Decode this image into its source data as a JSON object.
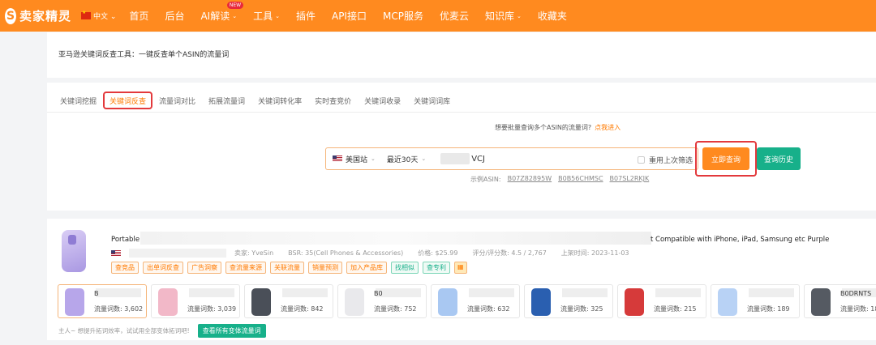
{
  "topbar": {
    "brand": "卖家精灵",
    "logo_letter": "S",
    "language": "中文",
    "nav": [
      {
        "label": "首页",
        "chevron": false
      },
      {
        "label": "后台",
        "chevron": false
      },
      {
        "label": "AI解读",
        "chevron": true,
        "badge": "NEW"
      },
      {
        "label": "工具",
        "chevron": true
      },
      {
        "label": "插件",
        "chevron": false
      },
      {
        "label": "API接口",
        "chevron": false
      },
      {
        "label": "MCP服务",
        "chevron": false
      },
      {
        "label": "优麦云",
        "chevron": false
      },
      {
        "label": "知识库",
        "chevron": true
      },
      {
        "label": "收藏夹",
        "chevron": false
      }
    ],
    "accent": "#ff8a1f"
  },
  "page": {
    "title": "亚马逊关键词反查工具：一键反查单个ASIN的流量词"
  },
  "tabs": [
    {
      "label": "关键词挖掘",
      "active": false
    },
    {
      "label": "关键词反查",
      "active": true
    },
    {
      "label": "流量词对比",
      "active": false
    },
    {
      "label": "拓展流量词",
      "active": false
    },
    {
      "label": "关键词转化率",
      "active": false
    },
    {
      "label": "实时查竞价",
      "active": false
    },
    {
      "label": "关键词收录",
      "active": false
    },
    {
      "label": "关键词词库",
      "active": false
    }
  ],
  "search": {
    "batch_tip": "想要批量查询多个ASIN的流量词?",
    "batch_link": "点我进入",
    "site": "美国站",
    "period": "最近30天",
    "asin_value": "VCJ",
    "reuse_label": "重用上次筛选",
    "query_button": "立即查询",
    "history_button": "查询历史",
    "examples_label": "示例ASIN:",
    "examples": [
      "B07Z82895W",
      "B0B56CHMSC",
      "B07SL2RKJK"
    ]
  },
  "product": {
    "title_start": "Portable",
    "title_end": "t Compatible with iPhone, iPad, Samsung etc Purple",
    "seller": "卖家: YveSin",
    "bsr": "BSR: 35(Cell Phones & Accessories)",
    "price": "价格: $25.99",
    "rating": "评分/评分数: 4.5 / 2,767",
    "launch": "上架时间: 2023-11-03",
    "tags": [
      {
        "label": "查竞品",
        "style": "orange"
      },
      {
        "label": "出单词反查",
        "style": "orange"
      },
      {
        "label": "广告洞察",
        "style": "orange"
      },
      {
        "label": "查流量来源",
        "style": "orange"
      },
      {
        "label": "关联流量",
        "style": "orange"
      },
      {
        "label": "销量预测",
        "style": "orange"
      },
      {
        "label": "加入产品库",
        "style": "orange"
      },
      {
        "label": "找相似",
        "style": "green"
      },
      {
        "label": "查专利",
        "style": "green"
      }
    ],
    "variants": [
      {
        "code": "B",
        "count": "流量词数: 3,602",
        "color": "#b7a6ea"
      },
      {
        "code": "",
        "count": "流量词数: 3,039",
        "color": "#f2b8c8"
      },
      {
        "code": "",
        "count": "流量词数: 842",
        "color": "#4a4f58"
      },
      {
        "code": "B0",
        "count": "流量词数: 752",
        "color": "#e9e9ec"
      },
      {
        "code": "",
        "count": "流量词数: 632",
        "color": "#a9c8f2"
      },
      {
        "code": "",
        "count": "流量词数: 325",
        "color": "#2a5fb0"
      },
      {
        "code": "",
        "count": "流量词数: 215",
        "color": "#d63a3a"
      },
      {
        "code": "",
        "count": "流量词数: 189",
        "color": "#b8d2f5"
      },
      {
        "code": "B0DRNTS",
        "count": "流量词数: 182",
        "color": "#555a62"
      }
    ],
    "footer_tip": "主人~ 想提升拓词效率，试试用全部变体拓词吧!",
    "all_variants_button": "查看所有变体流量词"
  }
}
